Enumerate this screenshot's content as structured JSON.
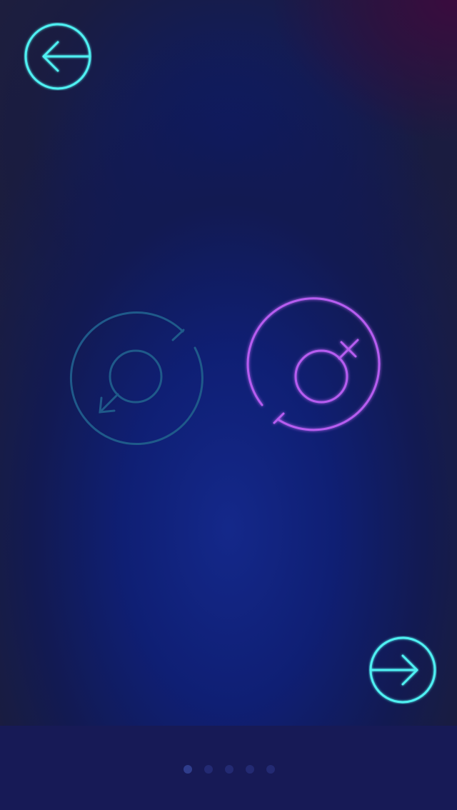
{
  "screen": {
    "name": "gender-selection"
  },
  "navigation": {
    "back_icon": "arrow-left-circle-icon",
    "next_icon": "arrow-right-circle-icon",
    "accent_color": "#4ff0f2"
  },
  "gender_options": [
    {
      "id": "male",
      "icon": "male-symbol-icon",
      "selected": false,
      "color": "#1f5a8a"
    },
    {
      "id": "female",
      "icon": "female-symbol-icon",
      "selected": true,
      "color": "#b65df0"
    }
  ],
  "pagination": {
    "total_pages": 5,
    "current_page": 1,
    "dot_color": "#232a73",
    "active_dot_color": "#2f3d8c"
  }
}
